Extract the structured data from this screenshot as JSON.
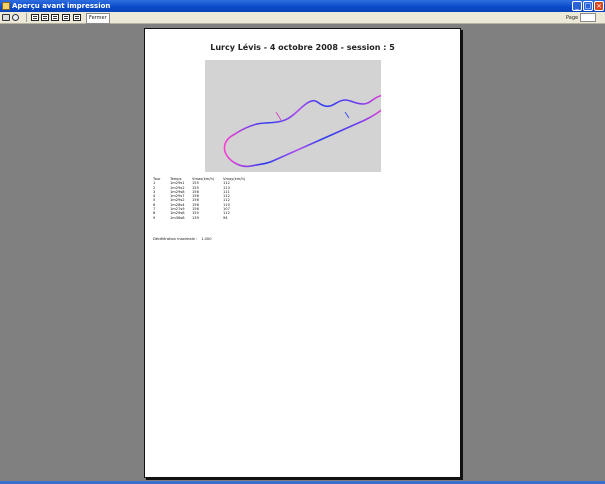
{
  "window": {
    "title": "Aperçu avant impression",
    "buttons": {
      "minimize": "_",
      "maximize": "□",
      "close": "×"
    }
  },
  "toolbar": {
    "close_label": "Fermer",
    "page_label": "Page"
  },
  "report": {
    "title": "Lurcy Lévis - 4 octobre 2008 - session : 5",
    "table": {
      "headers": [
        "Tour",
        "Temps",
        "Vmax(km/h)",
        "Vmoy(km/h)"
      ],
      "rows": [
        [
          "1",
          "1m29s1",
          "155",
          "112"
        ],
        [
          "2",
          "1m29s2",
          "155",
          "113"
        ],
        [
          "3",
          "1m29s8",
          "156",
          "111"
        ],
        [
          "4",
          "1m29s7",
          "156",
          "112"
        ],
        [
          "5",
          "1m29s2",
          "156",
          "112"
        ],
        [
          "6",
          "1m28s4",
          "156",
          "110"
        ],
        [
          "7",
          "1m27s9",
          "156",
          "107"
        ],
        [
          "8",
          "1m29s8",
          "155",
          "112"
        ],
        [
          "9",
          "1m36s8",
          "139",
          "94"
        ]
      ]
    },
    "summary": {
      "label": "Décélération maximale :",
      "value": "1.000"
    },
    "colors": {
      "track_fast": "#2a3cf0",
      "track_slow": "#ff3fd6",
      "plot_bg": "#d3d3d3"
    }
  }
}
